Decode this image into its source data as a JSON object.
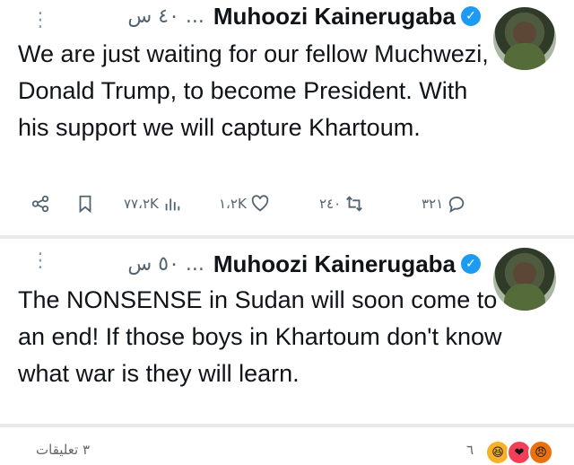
{
  "tweets": [
    {
      "name": "Muhoozi Kainerugaba",
      "time": "٤٠ س",
      "text": "We are just waiting for our fellow Muchwezi, Donald Trump, to become President. With his support we will capture Khartoum.",
      "stats": {
        "views": "٧٧،٢K",
        "likes": "١،٢K",
        "retweets": "٢٤٠",
        "replies": "٣٢١"
      }
    },
    {
      "name": "Muhoozi Kainerugaba",
      "time": "٥٠ س",
      "text": "The NONSENSE in Sudan will soon come to an end! If those boys in Khartoum don't know what war is they will learn."
    }
  ],
  "footer": {
    "comments": "٣ تعليقات",
    "count": "٦"
  },
  "colors": {
    "accent": "#1d9bf0",
    "muted": "#536471",
    "divider": "#e7e9ea"
  },
  "icons": [
    "share-icon",
    "bookmark-icon",
    "views-icon",
    "like-icon",
    "retweet-icon",
    "reply-icon",
    "verified-badge-icon",
    "more-options-icon"
  ]
}
